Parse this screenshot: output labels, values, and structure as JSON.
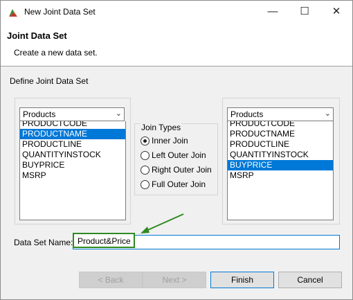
{
  "window": {
    "title": "New Joint Data Set",
    "minimize": "—",
    "maximize": "☐",
    "close": "✕"
  },
  "header": {
    "title": "Joint Data Set",
    "description": "Create a new data set."
  },
  "section_label": "Define Joint Data Set",
  "left": {
    "dataset": "Products",
    "items": [
      "PRODUCTCODE",
      "PRODUCTNAME",
      "PRODUCTLINE",
      "QUANTITYINSTOCK",
      "BUYPRICE",
      "MSRP"
    ],
    "selected": "PRODUCTNAME"
  },
  "right": {
    "dataset": "Products",
    "items": [
      "PRODUCTCODE",
      "PRODUCTNAME",
      "PRODUCTLINE",
      "QUANTITYINSTOCK",
      "BUYPRICE",
      "MSRP"
    ],
    "selected": "BUYPRICE"
  },
  "join_types": {
    "legend": "Join Types",
    "options": [
      "Inner Join",
      "Left Outer Join",
      "Right Outer Join",
      "Full Outer Join"
    ],
    "selected": "Inner Join"
  },
  "dataset_name": {
    "label": "Data Set Name:",
    "value": "Product&Price"
  },
  "buttons": {
    "back": "< Back",
    "next": "Next >",
    "finish": "Finish",
    "cancel": "Cancel"
  },
  "colors": {
    "selection": "#0078d7",
    "annotation": "#2d8a1f"
  },
  "icons": {
    "app": "report-app-icon",
    "arrow": "annotation-arrow-icon"
  }
}
